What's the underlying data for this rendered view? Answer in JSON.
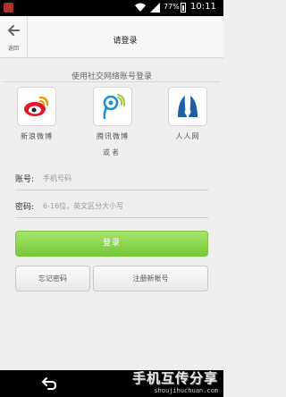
{
  "status_bar": {
    "battery": "77%",
    "time": "10:11"
  },
  "header": {
    "back_label": "返回",
    "title": "请登录"
  },
  "social": {
    "title": "使用社交网络账号登录",
    "items": [
      {
        "name": "新浪微博",
        "icon": "weibo-icon"
      },
      {
        "name": "腾讯微博",
        "icon": "tencent-weibo-icon"
      },
      {
        "name": "人人网",
        "icon": "renren-icon"
      }
    ],
    "or": "或者"
  },
  "form": {
    "account_label": "账号:",
    "account_placeholder": "手机号码",
    "password_label": "密码:",
    "password_placeholder": "6-16位，英文区分大小写"
  },
  "buttons": {
    "login": "登录",
    "forgot": "忘记密码",
    "register": "注册新帐号"
  },
  "watermark": {
    "text": "手机互传分享",
    "url": "shoujihuchuan.com"
  },
  "colors": {
    "login_green": "#8fd34f",
    "status_bar": "#000000"
  }
}
